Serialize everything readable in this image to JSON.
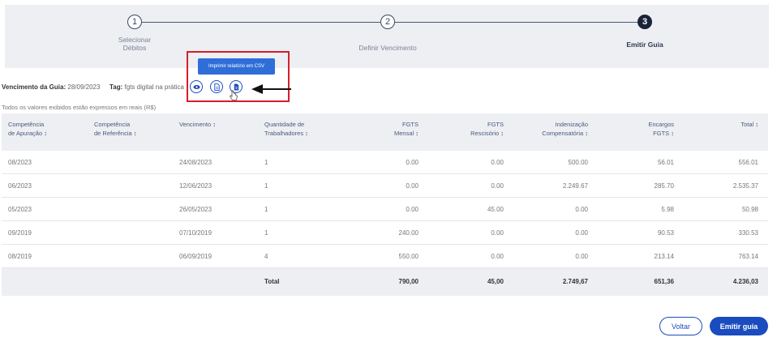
{
  "stepper": {
    "steps": [
      {
        "number": "1",
        "label_line1": "Selecionar",
        "label_line2": "Débitos"
      },
      {
        "number": "2",
        "label_line1": "Definir Vencimento",
        "label_line2": ""
      },
      {
        "number": "3",
        "label_line1": "Emitir Guia",
        "label_line2": ""
      }
    ]
  },
  "info": {
    "due_label": "Vencimento da Guia:",
    "due_value": "28/09/2023",
    "tag_label": "Tag:",
    "tag_value": "fgts digital na prática",
    "tooltip": "Imprimir relatório em CSV",
    "note": "Todos os valores exibidos estão expressos em reais (R$)"
  },
  "table": {
    "headers": {
      "competencia_apuracao": [
        "Competência",
        "de Apuração ↕"
      ],
      "competencia_referencia": [
        "Competência",
        "de Referência ↕"
      ],
      "vencimento": [
        "Vencimento ↕",
        ""
      ],
      "quantidade": [
        "Quantidade de",
        "Trabalhadores ↕"
      ],
      "fgts_mensal": [
        "FGTS",
        "Mensal ↕"
      ],
      "fgts_rescisorio": [
        "FGTS",
        "Rescisório ↕"
      ],
      "indenizacao": [
        "Indenização",
        "Compensatória ↕"
      ],
      "encargos": [
        "Encargos",
        "FGTS ↕"
      ],
      "total": [
        "Total ↕",
        ""
      ]
    },
    "rows": [
      {
        "apuracao": "08/2023",
        "referencia": "",
        "vencimento": "24/08/2023",
        "quantidade": "1",
        "mensal": "0.00",
        "rescisorio": "0.00",
        "indenizacao": "500.00",
        "encargos": "56.01",
        "total": "556.01"
      },
      {
        "apuracao": "06/2023",
        "referencia": "",
        "vencimento": "12/06/2023",
        "quantidade": "1",
        "mensal": "0.00",
        "rescisorio": "0.00",
        "indenizacao": "2.249.67",
        "encargos": "285.70",
        "total": "2.535.37"
      },
      {
        "apuracao": "05/2023",
        "referencia": "",
        "vencimento": "26/05/2023",
        "quantidade": "1",
        "mensal": "0.00",
        "rescisorio": "45.00",
        "indenizacao": "0.00",
        "encargos": "5.98",
        "total": "50.98"
      },
      {
        "apuracao": "09/2019",
        "referencia": "",
        "vencimento": "07/10/2019",
        "quantidade": "1",
        "mensal": "240.00",
        "rescisorio": "0.00",
        "indenizacao": "0.00",
        "encargos": "90.53",
        "total": "330.53"
      },
      {
        "apuracao": "08/2019",
        "referencia": "",
        "vencimento": "06/09/2019",
        "quantidade": "4",
        "mensal": "550.00",
        "rescisorio": "0.00",
        "indenizacao": "0.00",
        "encargos": "213.14",
        "total": "763.14"
      }
    ],
    "totals": {
      "label": "Total",
      "mensal": "790,00",
      "rescisorio": "45,00",
      "indenizacao": "2.749,67",
      "encargos": "651,36",
      "total": "4.236,03"
    }
  },
  "buttons": {
    "back": "Voltar",
    "emit": "Emitir guia"
  },
  "colors": {
    "primary": "#1b4cbf",
    "highlight": "#d51f27",
    "header_bg": "#edeff3"
  }
}
